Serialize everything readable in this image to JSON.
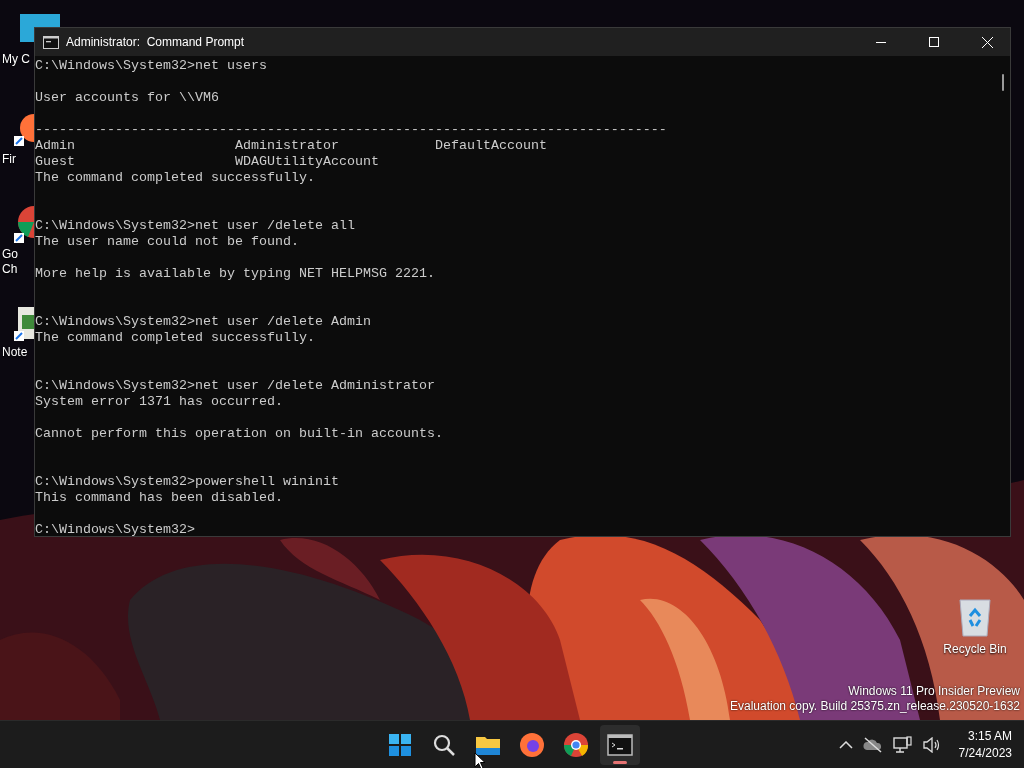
{
  "desktop_icons": [
    {
      "kind": "computer",
      "lines": [
        "My C"
      ]
    },
    {
      "kind": "firefox",
      "lines": [
        "Fir"
      ]
    },
    {
      "kind": "chrome",
      "lines": [
        "Go",
        "Ch"
      ]
    },
    {
      "kind": "notepad",
      "lines": [
        "Note"
      ]
    }
  ],
  "window": {
    "title": "Administrator:  Command Prompt",
    "lines": [
      {
        "kind": "text",
        "text": "C:\\Windows\\System32>net users"
      },
      {
        "kind": "blank"
      },
      {
        "kind": "text",
        "text": "User accounts for \\\\VM6"
      },
      {
        "kind": "blank"
      },
      {
        "kind": "text",
        "text": "-------------------------------------------------------------------------------"
      },
      {
        "kind": "text",
        "text": "Admin                    Administrator            DefaultAccount"
      },
      {
        "kind": "text",
        "text": "Guest                    WDAGUtilityAccount"
      },
      {
        "kind": "text",
        "text": "The command completed successfully."
      },
      {
        "kind": "blank"
      },
      {
        "kind": "blank"
      },
      {
        "kind": "text",
        "text": "C:\\Windows\\System32>net user /delete all"
      },
      {
        "kind": "text",
        "text": "The user name could not be found."
      },
      {
        "kind": "blank"
      },
      {
        "kind": "text",
        "text": "More help is available by typing NET HELPMSG 2221."
      },
      {
        "kind": "blank"
      },
      {
        "kind": "blank"
      },
      {
        "kind": "text",
        "text": "C:\\Windows\\System32>net user /delete Admin"
      },
      {
        "kind": "text",
        "text": "The command completed successfully."
      },
      {
        "kind": "blank"
      },
      {
        "kind": "blank"
      },
      {
        "kind": "text",
        "text": "C:\\Windows\\System32>net user /delete Administrator"
      },
      {
        "kind": "text",
        "text": "System error 1371 has occurred."
      },
      {
        "kind": "blank"
      },
      {
        "kind": "text",
        "text": "Cannot perform this operation on built-in accounts."
      },
      {
        "kind": "blank"
      },
      {
        "kind": "blank"
      },
      {
        "kind": "text",
        "text": "C:\\Windows\\System32>powershell wininit"
      },
      {
        "kind": "text",
        "text": "This command has been disabled."
      },
      {
        "kind": "blank"
      },
      {
        "kind": "text",
        "text": "C:\\Windows\\System32>"
      }
    ]
  },
  "recycle_bin": {
    "label": "Recycle Bin"
  },
  "watermark": [
    "Windows 11 Pro Insider Preview",
    "Evaluation copy. Build 25375.zn_release.230520-1632"
  ],
  "taskbar": {
    "apps": [
      {
        "kind": "start",
        "selected": false
      },
      {
        "kind": "search",
        "selected": false
      },
      {
        "kind": "explorer",
        "selected": false
      },
      {
        "kind": "firefox",
        "selected": false
      },
      {
        "kind": "chrome",
        "selected": false
      },
      {
        "kind": "terminal",
        "selected": true
      }
    ],
    "time": "3:15 AM",
    "date": "7/24/2023"
  }
}
